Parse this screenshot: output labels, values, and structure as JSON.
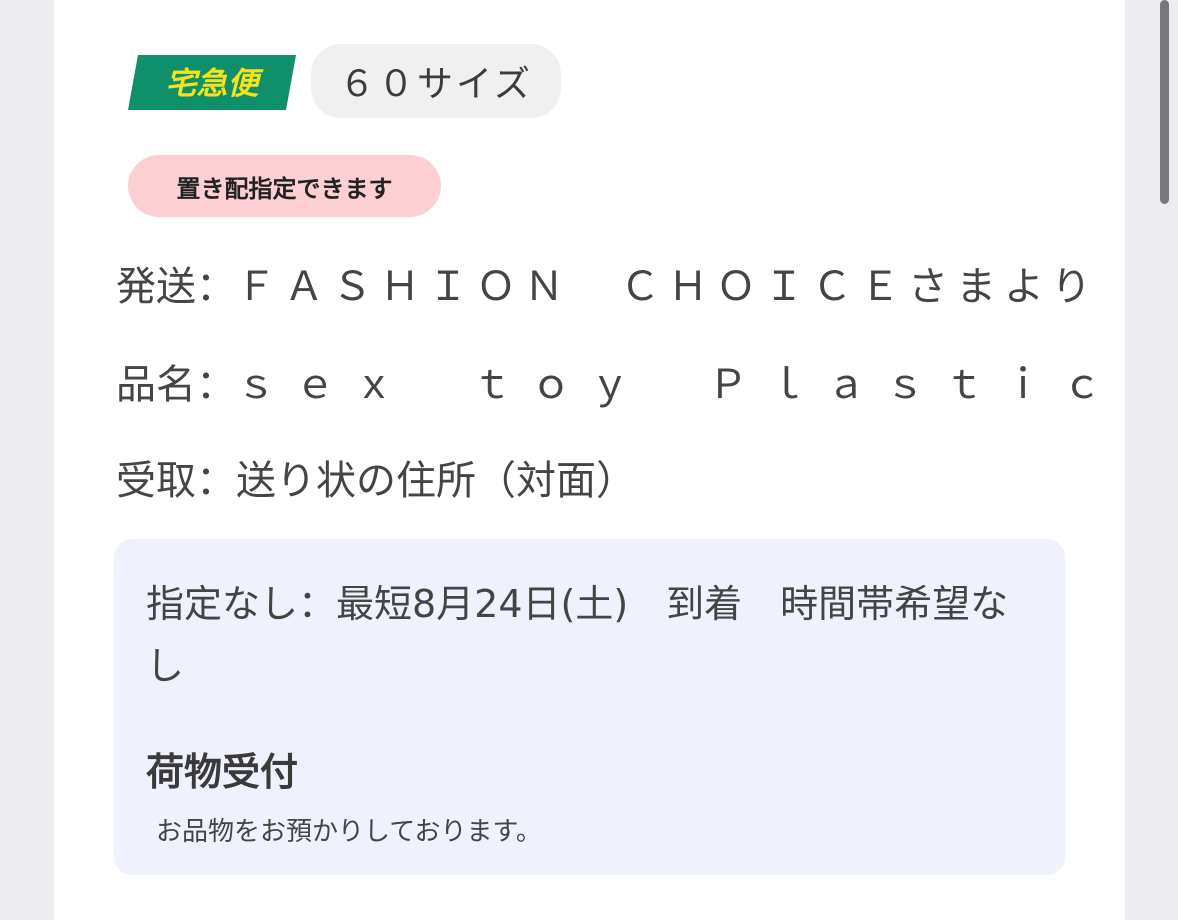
{
  "header": {
    "logo_text": "宅急便",
    "size_label": "６０サイズ"
  },
  "badge": {
    "label": "置き配指定できます"
  },
  "info": {
    "sender_label": "発送：",
    "sender_value": "ＦＡＳＨＩＯＮ　ＣＨＯＩＣＥさまより",
    "item_label": "品名：",
    "item_value": "ｓｅｘ　ｔｏｙ　Ｐｌａｓｔｉｃ",
    "receive_label": "受取：",
    "receive_value": "送り状の住所（対面）"
  },
  "delivery": {
    "schedule_text": "指定なし：最短8月24日(土)　到着　時間帯希望なし",
    "status_title": "荷物受付",
    "status_desc": "お品物をお預かりしております。"
  },
  "colors": {
    "logo_green": "#0f8f6a",
    "logo_yellow": "#f3e21c",
    "badge_pink": "#fcd0d2",
    "panel_blue": "#eff2fd"
  }
}
